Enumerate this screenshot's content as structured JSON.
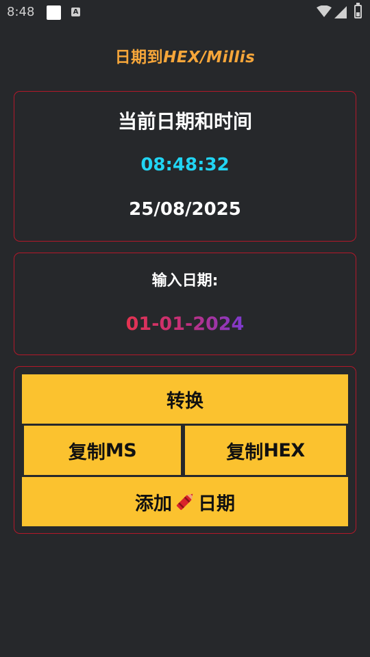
{
  "status_bar": {
    "time": "8:48",
    "icons": [
      "notification-square-icon",
      "a-badge-icon",
      "wifi-icon",
      "signal-icon",
      "battery-icon"
    ]
  },
  "app": {
    "title_cjk": "日期到",
    "title_latin": "HEX/Millis",
    "title_color": "#f6a63a"
  },
  "current_card": {
    "heading": "当前日期和时间",
    "time": "08:48:32",
    "date": "25/08/2025",
    "time_color": "#21d4f3"
  },
  "input_card": {
    "label": "输入日期:",
    "date_value": "01-01-2024"
  },
  "actions": {
    "convert_label": "转换",
    "copy_ms_prefix": "复制",
    "copy_ms_suffix": "MS",
    "copy_hex_prefix": "复制",
    "copy_hex_suffix": "HEX",
    "add_date_prefix": "添加",
    "add_date_icon": "crayon-icon",
    "add_date_suffix": "日期",
    "button_color": "#fbc22f"
  },
  "colors": {
    "background": "#26282b",
    "card_border": "#b3182a"
  }
}
